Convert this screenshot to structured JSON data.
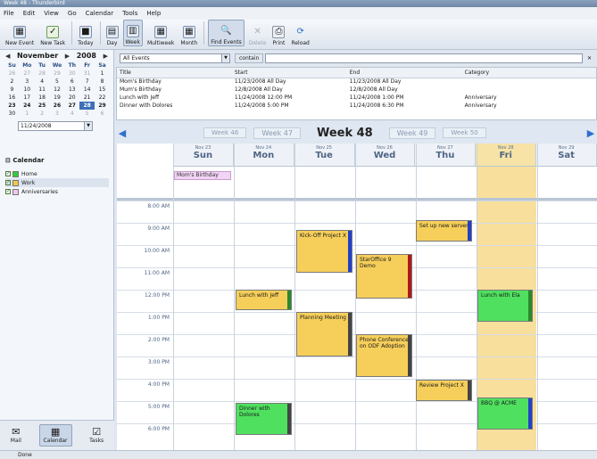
{
  "window": {
    "title": "Week 48 - Thunderbird"
  },
  "menu": [
    "File",
    "Edit",
    "View",
    "Go",
    "Calendar",
    "Tools",
    "Help"
  ],
  "toolbar": [
    {
      "label": "New Event",
      "icon": "new-event-icon"
    },
    {
      "label": "New Task",
      "icon": "new-task-icon"
    },
    {
      "label": "Today",
      "icon": "today-icon"
    },
    {
      "label": "Day",
      "icon": "day-view-icon"
    },
    {
      "label": "Week",
      "icon": "week-view-icon",
      "active": true
    },
    {
      "label": "Multiweek",
      "icon": "multiweek-view-icon"
    },
    {
      "label": "Month",
      "icon": "month-view-icon"
    },
    {
      "label": "Find Events",
      "icon": "find-events-icon",
      "active": true
    },
    {
      "label": "Delete",
      "icon": "delete-icon",
      "disabled": true
    },
    {
      "label": "Print",
      "icon": "print-icon"
    },
    {
      "label": "Reload",
      "icon": "reload-icon"
    }
  ],
  "minical": {
    "month": "November",
    "year": "2008",
    "dow": [
      "Su",
      "Mo",
      "Tu",
      "We",
      "Th",
      "Fr",
      "Sa"
    ],
    "rows": [
      [
        "26",
        "27",
        "28",
        "29",
        "30",
        "31",
        "1"
      ],
      [
        "2",
        "3",
        "4",
        "5",
        "6",
        "7",
        "8"
      ],
      [
        "9",
        "10",
        "11",
        "12",
        "13",
        "14",
        "15"
      ],
      [
        "16",
        "17",
        "18",
        "19",
        "20",
        "21",
        "22"
      ],
      [
        "23",
        "24",
        "25",
        "26",
        "27",
        "28",
        "29"
      ],
      [
        "30",
        "1",
        "2",
        "3",
        "4",
        "5",
        "6"
      ]
    ]
  },
  "date_field": "11/24/2008",
  "calendar_list": {
    "header": "Calendar",
    "items": [
      {
        "name": "Home",
        "color": "#2fcf37"
      },
      {
        "name": "Work",
        "color": "#f3c84a"
      },
      {
        "name": "Anniversaries",
        "color": "#f2c6f1"
      }
    ]
  },
  "bottom_tabs": [
    "Mail",
    "Calendar",
    "Tasks"
  ],
  "filter": {
    "select": "All Events",
    "contain": "contain",
    "search": ""
  },
  "event_list": {
    "headers": [
      "Title",
      "Start",
      "End",
      "Category"
    ],
    "rows": [
      [
        "Mom's Birthday",
        "11/23/2008 All Day",
        "11/23/2008 All Day",
        ""
      ],
      [
        "Mum's Birthday",
        "12/8/2008 All Day",
        "12/8/2008 All Day",
        ""
      ],
      [
        "Lunch with Jeff",
        "11/24/2008 12:00 PM",
        "11/24/2008 1:00 PM",
        "Anniversary"
      ],
      [
        "Dinner with Dolores",
        "11/24/2008 5:00 PM",
        "11/24/2008 6:30 PM",
        "Anniversary"
      ]
    ]
  },
  "weeks": {
    "prev2": "Week 46",
    "prev1": "Week 47",
    "current": "Week 48",
    "next1": "Week 49",
    "next2": "Week 50"
  },
  "days": [
    {
      "date": "Nov 23",
      "name": "Sun"
    },
    {
      "date": "Nov 24",
      "name": "Mon"
    },
    {
      "date": "Nov 25",
      "name": "Tue"
    },
    {
      "date": "Nov 26",
      "name": "Wed"
    },
    {
      "date": "Nov 27",
      "name": "Thu"
    },
    {
      "date": "Nov 28",
      "name": "Fri"
    },
    {
      "date": "Nov 29",
      "name": "Sat"
    }
  ],
  "allday_event": "Mom's Birthday",
  "hours": [
    "8:00 AM",
    "9:00 AM",
    "10:00 AM",
    "11:00 AM",
    "12:00 PM",
    "1:00 PM",
    "2:00 PM",
    "3:00 PM",
    "4:00 PM",
    "5:00 PM",
    "6:00 PM"
  ],
  "events": [
    {
      "title": "Kick-Off Project X",
      "color": "yellow",
      "tag": "#2340c8"
    },
    {
      "title": "Set up new server",
      "color": "yellow",
      "tag": "#2340c8"
    },
    {
      "title": "StarOffice 9 Demo",
      "color": "yellow",
      "tag": "#b0181a"
    },
    {
      "title": "Lunch with Jeff",
      "color": "yellow",
      "tag": "#2a8a2a"
    },
    {
      "title": "Lunch with Ela",
      "color": "green",
      "tag": "#2a8a2a"
    },
    {
      "title": "Planning Meeting",
      "color": "yellow",
      "tag": "#444444"
    },
    {
      "title": "Phone Conference on ODF Adoption",
      "color": "yellow",
      "tag": "#444444"
    },
    {
      "title": "Review Project X",
      "color": "yellow",
      "tag": "#444444"
    },
    {
      "title": "BBQ @ ACME",
      "color": "green",
      "tag": "#2340c8"
    },
    {
      "title": "Dinner with Dolores",
      "color": "green",
      "tag": "#444444"
    }
  ],
  "status": "Done"
}
